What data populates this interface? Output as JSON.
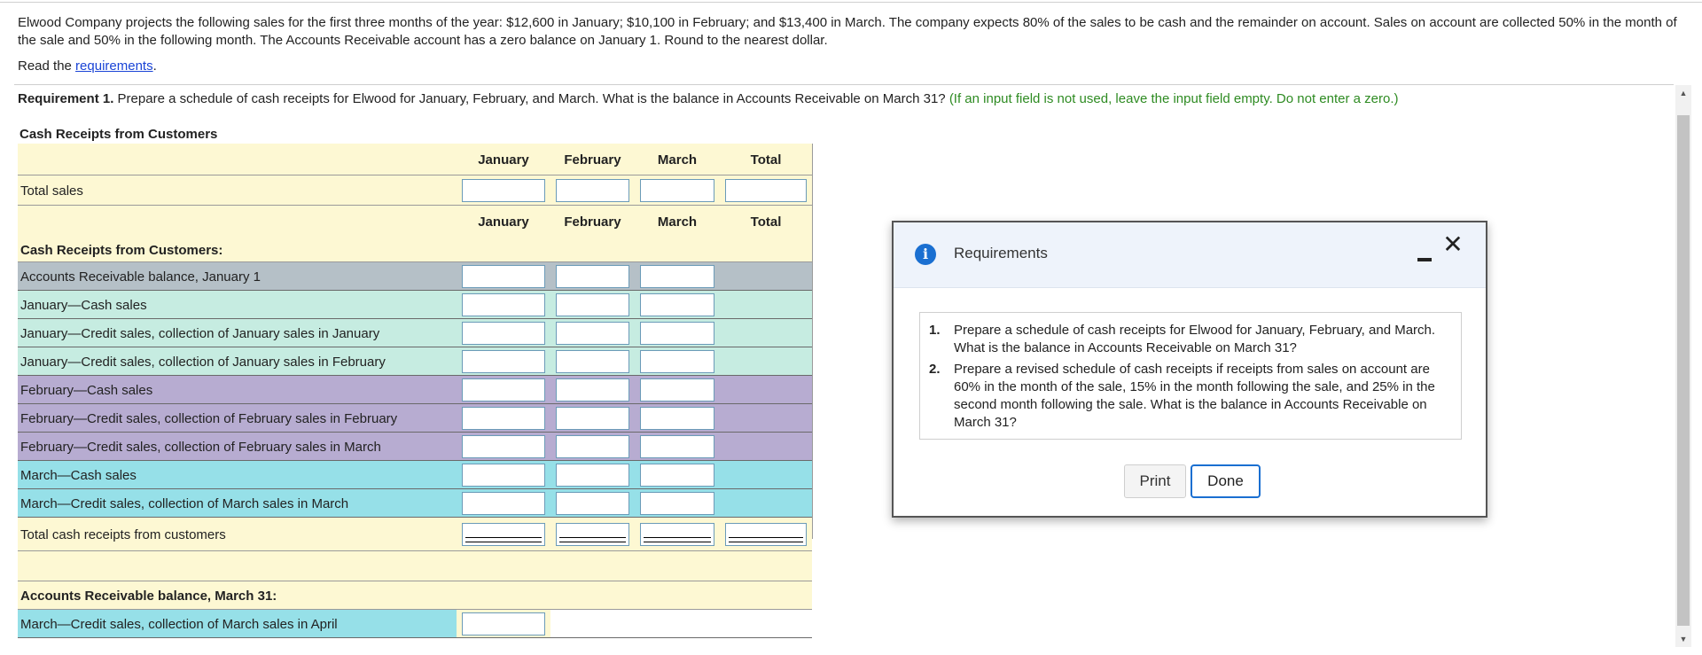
{
  "intro": {
    "text": "Elwood Company projects the following sales for the first three months of the year: $12,600 in January; $10,100 in February; and $13,400 in March. The company expects 80% of the sales to be cash and the remainder on account. Sales on account are collected 50% in the month of the sale and 50% in the following month. The Accounts Receivable account has a zero balance on January 1. Round to the nearest dollar.",
    "read_prefix": "Read the ",
    "read_link": "requirements",
    "read_suffix": "."
  },
  "requirement": {
    "label": "Requirement 1.",
    "text": " Prepare a schedule of cash receipts for Elwood for January, February, and March. What is the balance in Accounts Receivable on March 31? ",
    "hint": "(If an input field is not used, leave the input field empty. Do not enter a zero.)"
  },
  "schedule": {
    "title": "Cash Receipts from Customers",
    "columns": [
      "January",
      "February",
      "March",
      "Total"
    ],
    "total_sales_label": "Total sales",
    "section_label": "Cash Receipts from Customers:",
    "rows": [
      "Accounts Receivable balance, January 1",
      "January—Cash sales",
      "January—Credit sales, collection of January sales in January",
      "January—Credit sales, collection of January sales in February",
      "February—Cash sales",
      "February—Credit sales, collection of February sales in February",
      "February—Credit sales, collection of February sales in March",
      "March—Cash sales",
      "March—Credit sales, collection of March sales in March"
    ],
    "total_receipts_label": "Total cash receipts from customers",
    "ar_label": "Accounts Receivable balance, March 31:",
    "ar_row": "March—Credit sales, collection of March sales in April"
  },
  "colors": {
    "yellow": "#fdf8d3",
    "gray": "#b5c0c7",
    "mint": "#c6ece1",
    "purple": "#b7acd1",
    "cyan": "#96e0e8",
    "accent": "#1a6fd1"
  },
  "dialog": {
    "title": "Requirements",
    "icon": "info-icon",
    "close_glyph": "✕",
    "items": [
      {
        "num": "1.",
        "text": "Prepare a schedule of cash receipts for Elwood for January, February, and March. What is the balance in Accounts Receivable on March 31?"
      },
      {
        "num": "2.",
        "text": "Prepare a revised schedule of cash receipts if receipts from sales on account are 60% in the month of the sale, 15% in the month following the sale, and 25% in the second month following the sale. What is the balance in Accounts Receivable on March 31?"
      }
    ],
    "print_label": "Print",
    "done_label": "Done"
  }
}
